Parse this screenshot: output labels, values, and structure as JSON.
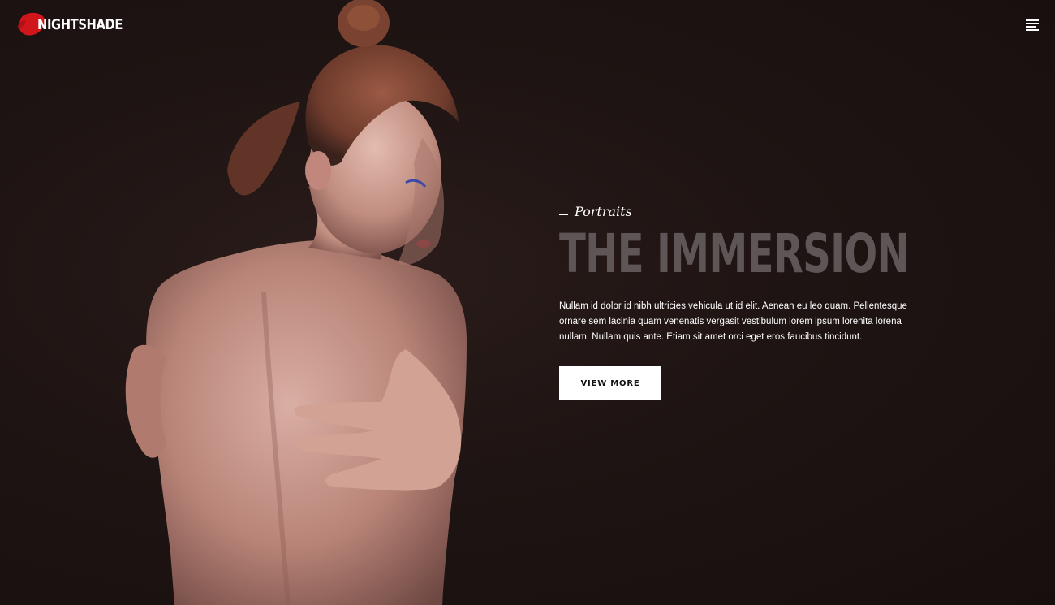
{
  "brand": {
    "name": "NIGHTSHADE",
    "logo_icon": "brush-stroke-logo",
    "accent_color": "#d0161b"
  },
  "header": {
    "menu_icon": "hamburger-menu-icon"
  },
  "hero": {
    "eyebrow": "Portraits",
    "title": "THE IMMERSION",
    "description": "Nullam id dolor id nibh ultricies vehicula ut id elit. Aenean eu leo quam. Pellentesque ornare sem lacinia quam venenatis vergasit vestibulum lorem ipsum lorenita lorena nullam. Nullam quis ante. Etiam sit amet orci eget eros faucibus tincidunt.",
    "cta_label": "VIEW MORE",
    "photo": "portrait-photo",
    "background_color": "#1d1312",
    "title_color": "#5e5656"
  }
}
